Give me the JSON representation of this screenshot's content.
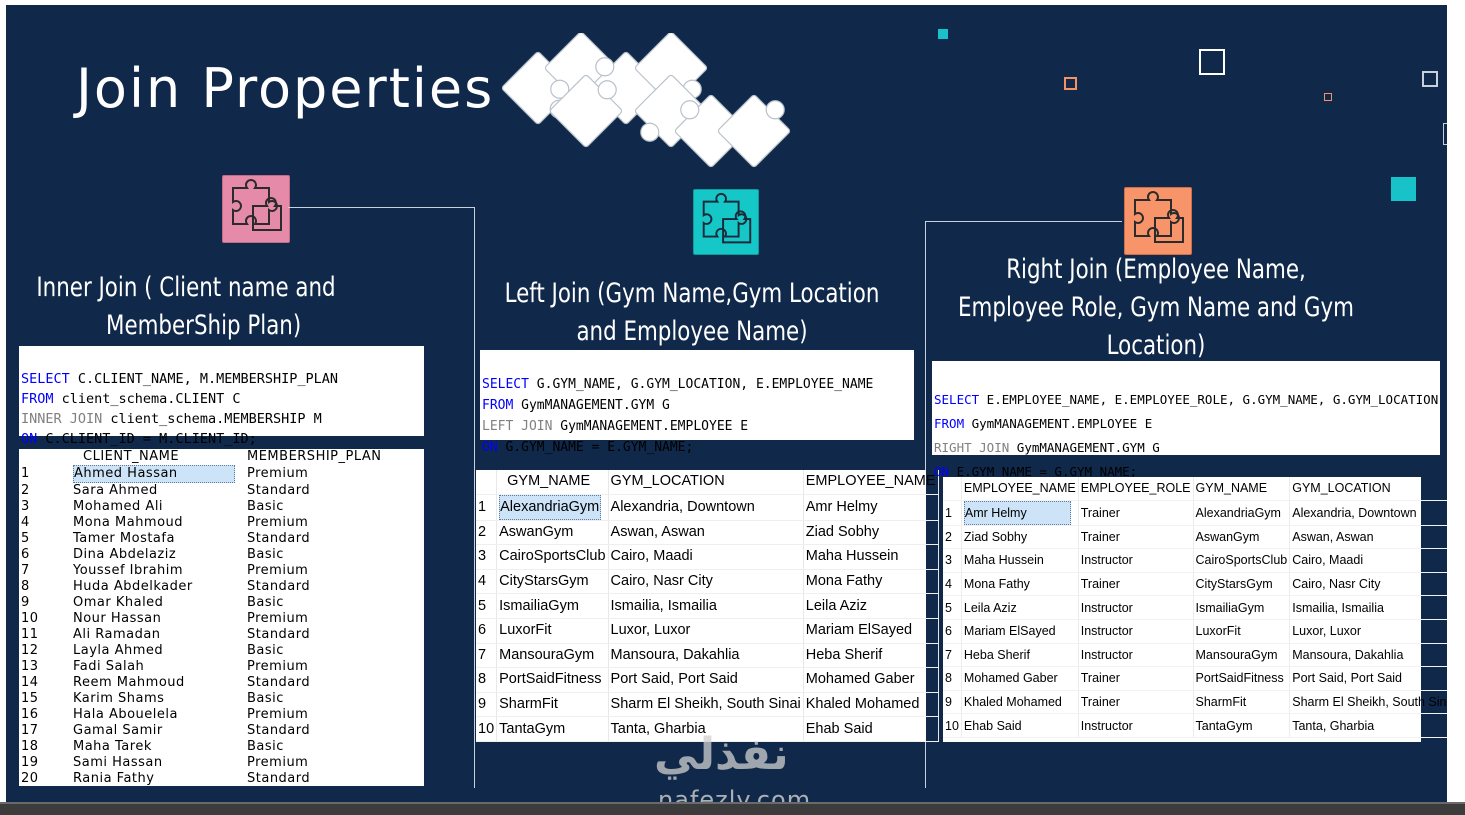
{
  "title": "Join Properties",
  "colors": {
    "background": "#10294a",
    "inner_icon": "#e58aa8",
    "left_icon": "#16c7c7",
    "right_icon": "#f8946a",
    "accent_teal": "#17c3c8",
    "accent_orange": "#f4935f"
  },
  "icons": {
    "puzzle_cluster": "puzzle-icon",
    "inner": "puzzle-icon",
    "left": "puzzle-icon",
    "right": "puzzle-icon"
  },
  "inner": {
    "title_line1": "Inner Join ( Client name and",
    "title_line2": "MemberShip Plan)",
    "sql": {
      "l1_kw": "SELECT",
      "l1_rest": " C.CLIENT_NAME, M.MEMBERSHIP_PLAN",
      "l2_kw": "FROM",
      "l2_rest": " client_schema.CLIENT C",
      "l3_kw": "INNER JOIN",
      "l3_rest": " client_schema.MEMBERSHIP M",
      "l4_kw": "ON",
      "l4_rest": " C.CLIENT_ID = M.CLIENT_ID;"
    },
    "columns": [
      "CLIENT_NAME",
      "MEMBERSHIP_PLAN"
    ],
    "rows": [
      [
        "1",
        "Ahmed Hassan",
        "Premium"
      ],
      [
        "2",
        "Sara Ahmed",
        "Standard"
      ],
      [
        "3",
        "Mohamed Ali",
        "Basic"
      ],
      [
        "4",
        "Mona Mahmoud",
        "Premium"
      ],
      [
        "5",
        "Tamer Mostafa",
        "Standard"
      ],
      [
        "6",
        "Dina Abdelaziz",
        "Basic"
      ],
      [
        "7",
        "Youssef Ibrahim",
        "Premium"
      ],
      [
        "8",
        "Huda Abdelkader",
        "Standard"
      ],
      [
        "9",
        "Omar Khaled",
        "Basic"
      ],
      [
        "10",
        "Nour Hassan",
        "Premium"
      ],
      [
        "11",
        "Ali Ramadan",
        "Standard"
      ],
      [
        "12",
        "Layla Ahmed",
        "Basic"
      ],
      [
        "13",
        "Fadi Salah",
        "Premium"
      ],
      [
        "14",
        "Reem Mahmoud",
        "Standard"
      ],
      [
        "15",
        "Karim Shams",
        "Basic"
      ],
      [
        "16",
        "Hala Abouelela",
        "Premium"
      ],
      [
        "17",
        "Gamal Samir",
        "Standard"
      ],
      [
        "18",
        "Maha Tarek",
        "Basic"
      ],
      [
        "19",
        "Sami Hassan",
        "Premium"
      ],
      [
        "20",
        "Rania Fathy",
        "Standard"
      ]
    ]
  },
  "left": {
    "title_line1": "Left Join (Gym Name,Gym Location",
    "title_line2": "and Employee Name)",
    "sql": {
      "l1_kw": "SELECT",
      "l1_rest": " G.GYM_NAME, G.GYM_LOCATION, E.EMPLOYEE_NAME",
      "l2_kw": "FROM",
      "l2_rest": " GymMANAGEMENT.GYM G",
      "l3_kw": "LEFT JOIN",
      "l3_rest": " GymMANAGEMENT.EMPLOYEE E",
      "l4_kw": "ON",
      "l4_rest": " G.GYM_NAME = E.GYM_NAME;"
    },
    "columns": [
      "GYM_NAME",
      "GYM_LOCATION",
      "EMPLOYEE_NAME"
    ],
    "rows": [
      [
        "1",
        "AlexandriaGym",
        "Alexandria, Downtown",
        "Amr Helmy"
      ],
      [
        "2",
        "AswanGym",
        "Aswan, Aswan",
        "Ziad Sobhy"
      ],
      [
        "3",
        "CairoSportsClub",
        "Cairo, Maadi",
        "Maha Hussein"
      ],
      [
        "4",
        "CityStarsGym",
        "Cairo, Nasr City",
        "Mona Fathy"
      ],
      [
        "5",
        "IsmailiaGym",
        "Ismailia, Ismailia",
        "Leila Aziz"
      ],
      [
        "6",
        "LuxorFit",
        "Luxor, Luxor",
        "Mariam ElSayed"
      ],
      [
        "7",
        "MansouraGym",
        "Mansoura, Dakahlia",
        "Heba Sherif"
      ],
      [
        "8",
        "PortSaidFitness",
        "Port Said, Port Said",
        "Mohamed Gaber"
      ],
      [
        "9",
        "SharmFit",
        "Sharm El Sheikh, South Sinai",
        "Khaled Mohamed"
      ],
      [
        "10",
        "TantaGym",
        "Tanta, Gharbia",
        "Ehab Said"
      ]
    ]
  },
  "right": {
    "title_line1": "Right Join (Employee Name,",
    "title_line2": "Employee Role, Gym Name and Gym",
    "title_line3": "Location)",
    "sql": {
      "l1_kw": "SELECT",
      "l1_rest": " E.EMPLOYEE_NAME, E.EMPLOYEE_ROLE, G.GYM_NAME, G.GYM_LOCATION",
      "l2_kw": "FROM",
      "l2_rest": " GymMANAGEMENT.EMPLOYEE E",
      "l3_kw": "RIGHT JOIN",
      "l3_rest": " GymMANAGEMENT.GYM G",
      "l4_kw": "ON",
      "l4_rest": " E.GYM_NAME = G.GYM_NAME;"
    },
    "columns": [
      "EMPLOYEE_NAME",
      "EMPLOYEE_ROLE",
      "GYM_NAME",
      "GYM_LOCATION"
    ],
    "rows": [
      [
        "1",
        "Amr Helmy",
        "Trainer",
        "AlexandriaGym",
        "Alexandria, Downtown"
      ],
      [
        "2",
        "Ziad Sobhy",
        "Trainer",
        "AswanGym",
        "Aswan, Aswan"
      ],
      [
        "3",
        "Maha Hussein",
        "Instructor",
        "CairoSportsClub",
        "Cairo, Maadi"
      ],
      [
        "4",
        "Mona Fathy",
        "Trainer",
        "CityStarsGym",
        "Cairo, Nasr City"
      ],
      [
        "5",
        "Leila Aziz",
        "Instructor",
        "IsmailiaGym",
        "Ismailia, Ismailia"
      ],
      [
        "6",
        "Mariam ElSayed",
        "Instructor",
        "LuxorFit",
        "Luxor, Luxor"
      ],
      [
        "7",
        "Heba Sherif",
        "Instructor",
        "MansouraGym",
        "Mansoura, Dakahlia"
      ],
      [
        "8",
        "Mohamed Gaber",
        "Trainer",
        "PortSaidFitness",
        "Port Said, Port Said"
      ],
      [
        "9",
        "Khaled Mohamed",
        "Trainer",
        "SharmFit",
        "Sharm El Sheikh, South Sinai"
      ],
      [
        "10",
        "Ehab Said",
        "Instructor",
        "TantaGym",
        "Tanta, Gharbia"
      ]
    ]
  },
  "watermark": {
    "arabic": "نفذلي",
    "latin": "nafezly.com"
  }
}
